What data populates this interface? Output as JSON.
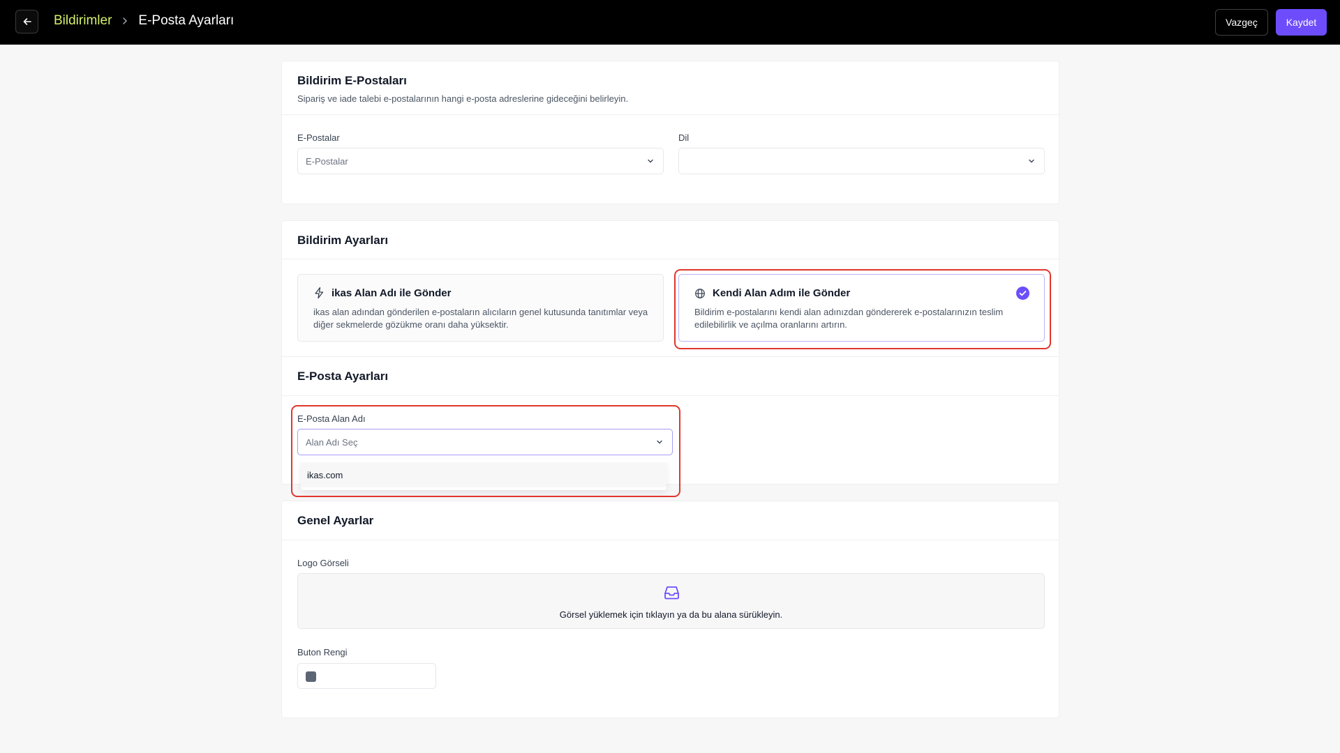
{
  "header": {
    "breadcrumb_parent": "Bildirimler",
    "page_title": "E-Posta Ayarları",
    "cancel_label": "Vazgeç",
    "save_label": "Kaydet"
  },
  "notification_emails": {
    "title": "Bildirim E-Postaları",
    "description": "Sipariş ve iade talebi e-postalarının hangi e-posta adreslerine gideceğini belirleyin.",
    "emails_label": "E-Postalar",
    "emails_placeholder": "E-Postalar",
    "language_label": "Dil",
    "language_value": ""
  },
  "notification_settings": {
    "title": "Bildirim Ayarları",
    "options": [
      {
        "title": "ikas Alan Adı ile Gönder",
        "description": "ikas alan adından gönderilen e-postaların alıcıların genel kutusunda tanıtımlar veya diğer sekmelerde gözükme oranı daha yüksektir.",
        "icon": "lightning-icon",
        "selected": false
      },
      {
        "title": "Kendi Alan Adım ile Gönder",
        "description": "Bildirim e-postalarını kendi alan adınızdan göndererek e-postalarınızın teslim edilebilirlik ve açılma oranlarını artırın.",
        "icon": "globe-icon",
        "selected": true
      }
    ]
  },
  "email_settings": {
    "title": "E-Posta Ayarları",
    "domain_label": "E-Posta Alan Adı",
    "domain_placeholder": "Alan Adı Seç",
    "domain_options": [
      "ikas.com"
    ]
  },
  "general_settings": {
    "title": "Genel Ayarlar",
    "logo_label": "Logo Görseli",
    "upload_text": "Görsel yüklemek için tıklayın ya da bu alana sürükleyin.",
    "button_color_label": "Buton Rengi",
    "button_color": "#5b6576"
  },
  "colors": {
    "accent": "#6d4dfb",
    "breadcrumb_parent": "#d4f06a",
    "highlight": "#e0362c"
  }
}
